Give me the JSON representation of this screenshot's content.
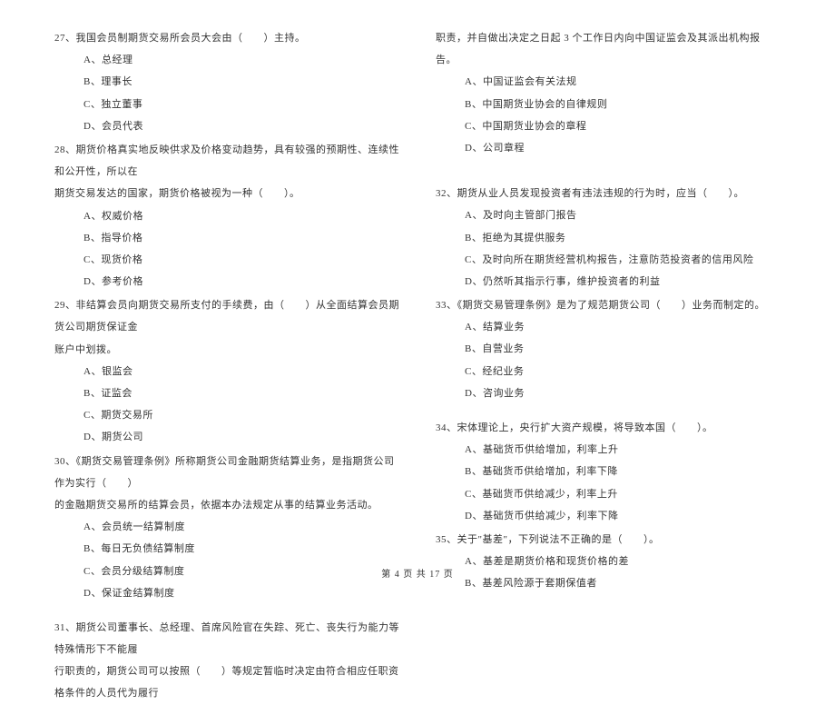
{
  "left": {
    "q27": {
      "text": "27、我国会员制期货交易所会员大会由（　　）主持。",
      "a": "A、总经理",
      "b": "B、理事长",
      "c": "C、独立董事",
      "d": "D、会员代表"
    },
    "q28": {
      "text1": "28、期货价格真实地反映供求及价格变动趋势，具有较强的预期性、连续性和公开性，所以在",
      "text2": "期货交易发达的国家，期货价格被视为一种（　　）。",
      "a": "A、权威价格",
      "b": "B、指导价格",
      "c": "C、现货价格",
      "d": "D、参考价格"
    },
    "q29": {
      "text1": "29、非结算会员向期货交易所支付的手续费，由（　　）从全面结算会员期货公司期货保证金",
      "text2": "账户中划拨。",
      "a": "A、银监会",
      "b": "B、证监会",
      "c": "C、期货交易所",
      "d": "D、期货公司"
    },
    "q30": {
      "text1": "30、《期货交易管理条例》所称期货公司金融期货结算业务，是指期货公司作为实行（　　）",
      "text2": "的金融期货交易所的结算会员，依据本办法规定从事的结算业务活动。",
      "a": "A、会员统一结算制度",
      "b": "B、每日无负债结算制度",
      "c": "C、会员分级结算制度",
      "d": "D、保证金结算制度"
    },
    "q31": {
      "text1": "31、期货公司董事长、总经理、首席风险官在失踪、死亡、丧失行为能力等特殊情形下不能履",
      "text2": "行职责的，期货公司可以按照（　　）等规定暂临时决定由符合相应任职资格条件的人员代为履行"
    }
  },
  "right": {
    "q31cont": {
      "text": "职责，并自做出决定之日起 3 个工作日内向中国证监会及其派出机构报告。",
      "a": "A、中国证监会有关法规",
      "b": "B、中国期货业协会的自律规则",
      "c": "C、中国期货业协会的章程",
      "d": "D、公司章程"
    },
    "q32": {
      "text": "32、期货从业人员发现投资者有违法违规的行为时，应当（　　）。",
      "a": "A、及时向主管部门报告",
      "b": "B、拒绝为其提供服务",
      "c": "C、及时向所在期货经营机构报告，注意防范投资者的信用风险",
      "d": "D、仍然听其指示行事，维护投资者的利益"
    },
    "q33": {
      "text": "33、《期货交易管理条例》是为了规范期货公司（　　）业务而制定的。",
      "a": "A、结算业务",
      "b": "B、自营业务",
      "c": "C、经纪业务",
      "d": "D、咨询业务"
    },
    "q34": {
      "text": "34、宋体理论上，央行扩大资产规模，将导致本国（　　）。",
      "a": "A、基础货币供给增加，利率上升",
      "b": "B、基础货币供给增加，利率下降",
      "c": "C、基础货币供给减少，利率上升",
      "d": "D、基础货币供给减少，利率下降"
    },
    "q35": {
      "text": "35、关于\"基差\"，下列说法不正确的是（　　）。",
      "a": "A、基差是期货价格和现货价格的差",
      "b": "B、基差风险源于套期保值者"
    }
  },
  "footer": "第 4 页 共 17 页"
}
